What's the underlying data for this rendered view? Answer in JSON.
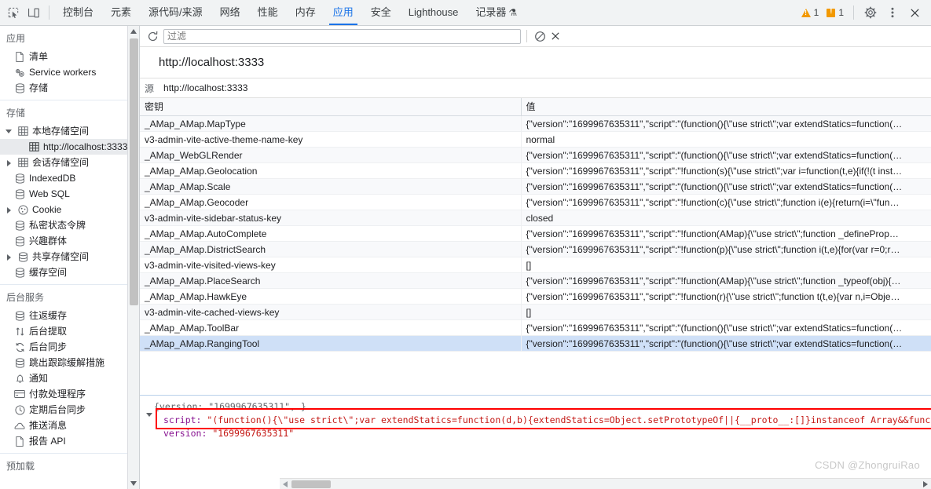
{
  "toolbar": {
    "inspect_icon": "inspect-element-icon",
    "device_icon": "device-toolbar-icon",
    "tabs": [
      {
        "label": "控制台",
        "active": false
      },
      {
        "label": "元素",
        "active": false
      },
      {
        "label": "源代码/来源",
        "active": false
      },
      {
        "label": "网络",
        "active": false
      },
      {
        "label": "性能",
        "active": false
      },
      {
        "label": "内存",
        "active": false
      },
      {
        "label": "应用",
        "active": true
      },
      {
        "label": "安全",
        "active": false
      },
      {
        "label": "Lighthouse",
        "active": false
      },
      {
        "label": "记录器",
        "active": false,
        "suffix": "⚗"
      }
    ],
    "warning_count": "1",
    "error_count": "1",
    "settings_icon": "gear-icon",
    "more_icon": "more-vertical-icon",
    "close_icon": "close-icon"
  },
  "sidebar": {
    "groups": [
      {
        "title": "应用",
        "items": [
          {
            "label": "清单",
            "icon": "document-icon",
            "arrow": "none",
            "level": 1,
            "selected": false
          },
          {
            "label": "Service workers",
            "icon": "gears-icon",
            "arrow": "none",
            "level": 1,
            "selected": false
          },
          {
            "label": "存储",
            "icon": "database-icon",
            "arrow": "none",
            "level": 1,
            "selected": false
          }
        ]
      },
      {
        "title": "存储",
        "items": [
          {
            "label": "本地存储空间",
            "icon": "table-icon",
            "arrow": "open",
            "level": 1,
            "selected": false
          },
          {
            "label": "http://localhost:3333",
            "icon": "table-icon",
            "arrow": "none",
            "level": 2,
            "selected": true
          },
          {
            "label": "会话存储空间",
            "icon": "table-icon",
            "arrow": "closed",
            "level": 1,
            "selected": false
          },
          {
            "label": "IndexedDB",
            "icon": "database-icon",
            "arrow": "none",
            "level": 1,
            "selected": false
          },
          {
            "label": "Web SQL",
            "icon": "database-icon",
            "arrow": "none",
            "level": 1,
            "selected": false
          },
          {
            "label": "Cookie",
            "icon": "cookie-icon",
            "arrow": "closed",
            "level": 1,
            "selected": false
          },
          {
            "label": "私密状态令牌",
            "icon": "database-icon",
            "arrow": "none",
            "level": 1,
            "selected": false
          },
          {
            "label": "兴趣群体",
            "icon": "database-icon",
            "arrow": "none",
            "level": 1,
            "selected": false
          },
          {
            "label": "共享存储空间",
            "icon": "database-icon",
            "arrow": "closed",
            "level": 1,
            "selected": false
          },
          {
            "label": "缓存空间",
            "icon": "database-icon",
            "arrow": "none",
            "level": 1,
            "selected": false
          }
        ]
      },
      {
        "title": "后台服务",
        "items": [
          {
            "label": "往返缓存",
            "icon": "database-icon",
            "arrow": "none",
            "level": 1,
            "selected": false
          },
          {
            "label": "后台提取",
            "icon": "arrows-updown-icon",
            "arrow": "none",
            "level": 1,
            "selected": false
          },
          {
            "label": "后台同步",
            "icon": "sync-icon",
            "arrow": "none",
            "level": 1,
            "selected": false
          },
          {
            "label": "跳出跟踪缓解措施",
            "icon": "database-icon",
            "arrow": "none",
            "level": 1,
            "selected": false
          },
          {
            "label": "通知",
            "icon": "bell-icon",
            "arrow": "none",
            "level": 1,
            "selected": false
          },
          {
            "label": "付款处理程序",
            "icon": "credit-card-icon",
            "arrow": "none",
            "level": 1,
            "selected": false
          },
          {
            "label": "定期后台同步",
            "icon": "clock-icon",
            "arrow": "none",
            "level": 1,
            "selected": false
          },
          {
            "label": "推送消息",
            "icon": "cloud-icon",
            "arrow": "none",
            "level": 1,
            "selected": false
          },
          {
            "label": "报告 API",
            "icon": "document-icon",
            "arrow": "none",
            "level": 1,
            "selected": false
          }
        ]
      },
      {
        "title": "预加载",
        "items": []
      }
    ]
  },
  "filterbar": {
    "refresh_icon": "refresh-icon",
    "filter_value": "",
    "filter_placeholder": "过滤",
    "clear_all_icon": "no-entry-icon",
    "delete_icon": "close-icon"
  },
  "origin": {
    "title": "http://localhost:3333",
    "label": "源",
    "value": "http://localhost:3333"
  },
  "table": {
    "columns": [
      "密钥",
      "值"
    ],
    "rows": [
      {
        "key": "_AMap_AMap.MapType",
        "value": "{\"version\":\"1699967635311\",\"script\":\"(function(){\\\"use strict\\\";var extendStatics=function(…",
        "selected": false
      },
      {
        "key": "v3-admin-vite-active-theme-name-key",
        "value": "normal",
        "selected": false
      },
      {
        "key": "_AMap_WebGLRender",
        "value": "{\"version\":\"1699967635311\",\"script\":\"(function(){\\\"use strict\\\";var extendStatics=function(…",
        "selected": false
      },
      {
        "key": "_AMap_AMap.Geolocation",
        "value": "{\"version\":\"1699967635311\",\"script\":\"!function(s){\\\"use strict\\\";var i=function(t,e){if(!(t inst…",
        "selected": false
      },
      {
        "key": "_AMap_AMap.Scale",
        "value": "{\"version\":\"1699967635311\",\"script\":\"(function(){\\\"use strict\\\";var extendStatics=function(…",
        "selected": false
      },
      {
        "key": "_AMap_AMap.Geocoder",
        "value": "{\"version\":\"1699967635311\",\"script\":\"!function(c){\\\"use strict\\\";function i(e){return(i=\\\"fun…",
        "selected": false
      },
      {
        "key": "v3-admin-vite-sidebar-status-key",
        "value": "closed",
        "selected": false
      },
      {
        "key": "_AMap_AMap.AutoComplete",
        "value": "{\"version\":\"1699967635311\",\"script\":\"!function(AMap){\\\"use strict\\\";function _defineProp…",
        "selected": false
      },
      {
        "key": "_AMap_AMap.DistrictSearch",
        "value": "{\"version\":\"1699967635311\",\"script\":\"!function(p){\\\"use strict\\\";function i(t,e){for(var r=0;r…",
        "selected": false
      },
      {
        "key": "v3-admin-vite-visited-views-key",
        "value": "[]",
        "selected": false
      },
      {
        "key": "_AMap_AMap.PlaceSearch",
        "value": "{\"version\":\"1699967635311\",\"script\":\"!function(AMap){\\\"use strict\\\";function _typeof(obj){…",
        "selected": false
      },
      {
        "key": "_AMap_AMap.HawkEye",
        "value": "{\"version\":\"1699967635311\",\"script\":\"!function(r){\\\"use strict\\\";function t(t,e){var n,i=Obje…",
        "selected": false
      },
      {
        "key": "v3-admin-vite-cached-views-key",
        "value": "[]",
        "selected": false
      },
      {
        "key": "_AMap_AMap.ToolBar",
        "value": "{\"version\":\"1699967635311\",\"script\":\"(function(){\\\"use strict\\\";var extendStatics=function(…",
        "selected": false
      },
      {
        "key": "_AMap_AMap.RangingTool",
        "value": "{\"version\":\"1699967635311\",\"script\":\"(function(){\\\"use strict\\\";var extendStatics=function(…",
        "selected": true
      }
    ]
  },
  "preview": {
    "root_line": "{version: \"1699967635311\",…}",
    "script_key": "script:",
    "script_value": "\"(function(){\\\"use strict\\\";var extendStatics=function(d,b){extendStatics=Object.setPrototypeOf||{__proto__:[]}instanceof Array&&functio",
    "version_key": "version:",
    "version_value": "\"1699967635311\"",
    "highlight_color": "#ff0000"
  },
  "watermark": "CSDN @ZhongruiRao",
  "colors": {
    "accent": "#1a73e8",
    "selected_row": "#cfe0f7",
    "warning": "#f29900",
    "highlight": "#ff0000"
  }
}
